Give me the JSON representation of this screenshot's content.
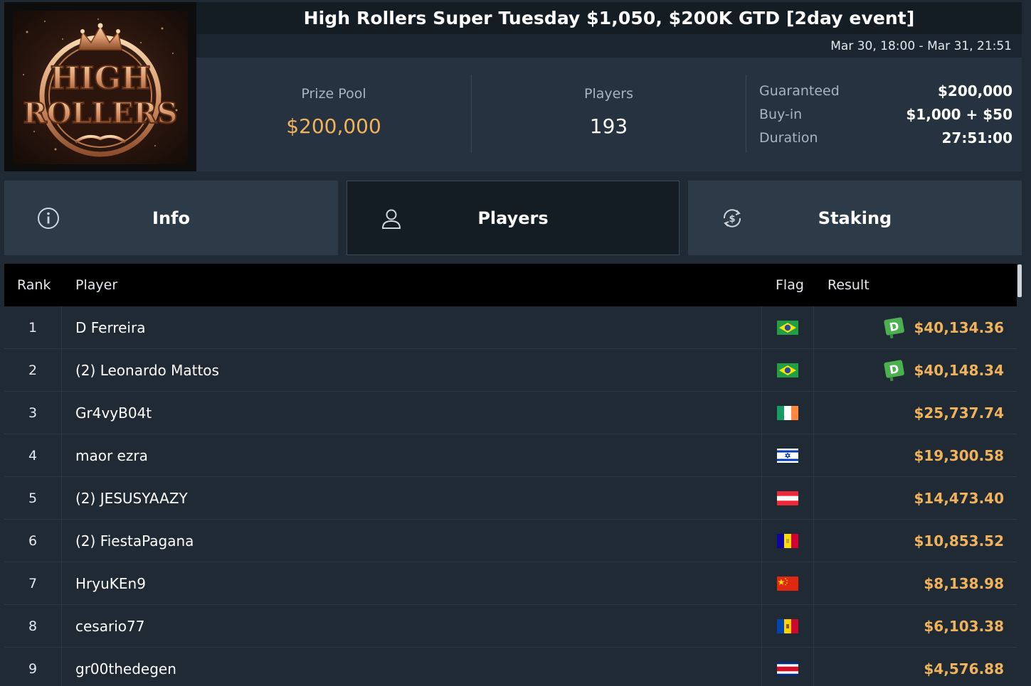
{
  "tournament": {
    "title": "High Rollers Super Tuesday $1,050, $200K GTD [2day event]",
    "dates": "Mar 30, 18:00 - Mar 31, 21:51",
    "logo_text_top": "HIGH",
    "logo_text_bottom": "ROLLERS"
  },
  "stats": {
    "prize_pool_label": "Prize Pool",
    "prize_pool_value": "$200,000",
    "players_label": "Players",
    "players_value": "193",
    "guaranteed_label": "Guaranteed",
    "guaranteed_value": "$200,000",
    "buyin_label": "Buy-in",
    "buyin_value": "$1,000 + $50",
    "duration_label": "Duration",
    "duration_value": "27:51:00"
  },
  "tabs": [
    {
      "label": "Info",
      "icon": "info-icon",
      "active": false
    },
    {
      "label": "Players",
      "icon": "user-icon",
      "active": true
    },
    {
      "label": "Staking",
      "icon": "dollar-refresh-icon",
      "active": false
    }
  ],
  "table": {
    "headers": {
      "rank": "Rank",
      "player": "Player",
      "flag": "Flag",
      "result": "Result"
    },
    "rows": [
      {
        "rank": "1",
        "player": "D Ferreira",
        "flag": "brazil",
        "result": "$40,134.36",
        "deal": true,
        "deal_label": "D"
      },
      {
        "rank": "2",
        "player": "(2) Leonardo Mattos",
        "flag": "brazil",
        "result": "$40,148.34",
        "deal": true,
        "deal_label": "D"
      },
      {
        "rank": "3",
        "player": "Gr4vyB04t",
        "flag": "ireland",
        "result": "$25,737.74",
        "deal": false
      },
      {
        "rank": "4",
        "player": "maor ezra",
        "flag": "israel",
        "result": "$19,300.58",
        "deal": false
      },
      {
        "rank": "5",
        "player": "(2) JESUSYAAZY",
        "flag": "austria",
        "result": "$14,473.40",
        "deal": false
      },
      {
        "rank": "6",
        "player": "(2) FiestaPagana",
        "flag": "andorra",
        "result": "$10,853.52",
        "deal": false
      },
      {
        "rank": "7",
        "player": "HryuKEn9",
        "flag": "china",
        "result": "$8,138.98",
        "deal": false
      },
      {
        "rank": "8",
        "player": "cesario77",
        "flag": "moldova",
        "result": "$6,103.38",
        "deal": false
      },
      {
        "rank": "9",
        "player": "gr00thedegen",
        "flag": "costa-rica",
        "result": "$4,576.88",
        "deal": false
      }
    ]
  },
  "colors": {
    "accent_gold": "#f0b35b",
    "deal_badge_green": "#4caf50",
    "background": "#1f2a35"
  }
}
